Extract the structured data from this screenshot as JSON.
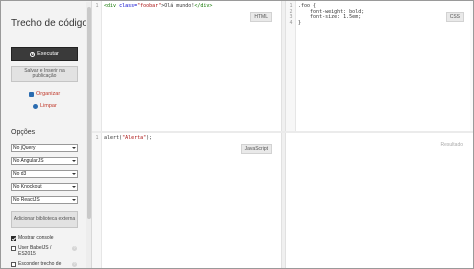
{
  "sidebar": {
    "title": "Trecho de código",
    "run_button": "Executar",
    "save_button": "Salvar e Inserir na publicação",
    "organize_link": "Organizar",
    "clear_link": "Limpar",
    "options_label": "Opções",
    "selects": [
      {
        "value": "No jQuery"
      },
      {
        "value": "No AngularJS"
      },
      {
        "value": "No d3"
      },
      {
        "value": "No Knockout"
      },
      {
        "value": "No ReactJS"
      }
    ],
    "add_library_button": "Adicionar biblioteca externa",
    "checks": [
      {
        "label": "Mostrar console",
        "checked": true
      },
      {
        "label": "User BabelJS / ES2015",
        "checked": false
      },
      {
        "label": "Esconder trecho de",
        "checked": false
      }
    ],
    "help_glyph": "?"
  },
  "panels": {
    "html": {
      "label": "HTML",
      "lines": [
        {
          "n": "1",
          "tag_open": "<div ",
          "attr": "class=",
          "str": "\"foobar\"",
          "text": ">Olá mundo!",
          "tag_close": "</div>"
        }
      ]
    },
    "css": {
      "label": "CSS",
      "lines": [
        {
          "n": "1",
          "text": ".foo {"
        },
        {
          "n": "2",
          "text": "    font-weight: bold;"
        },
        {
          "n": "3",
          "text": "    font-size: 1.5em;"
        },
        {
          "n": "4",
          "text": "}"
        }
      ]
    },
    "js": {
      "label": "JavaScript",
      "lines": [
        {
          "n": "1",
          "pre": "alert(",
          "str": "\"Alerta\"",
          "post": ");"
        }
      ]
    },
    "result": {
      "label": "Resultado"
    }
  }
}
